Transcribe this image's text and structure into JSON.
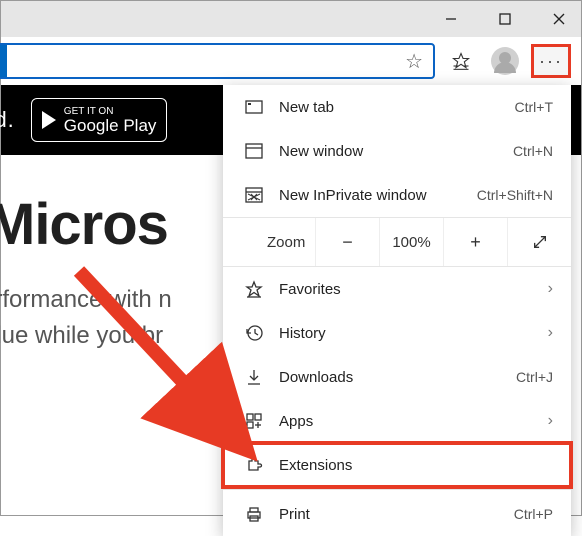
{
  "window": {
    "minimize": "—",
    "close": "×"
  },
  "toolbar": {
    "more": "···"
  },
  "banner": {
    "tail": "roid.",
    "gplay_small": "GET IT ON",
    "gplay_big": "Google Play"
  },
  "page": {
    "heading_fragment": "  Micros",
    "line1_fragment": "erformance with n",
    "line2_fragment": "alue while you br"
  },
  "menu": {
    "newtab": {
      "label": "New tab",
      "accel": "Ctrl+T"
    },
    "newwin": {
      "label": "New window",
      "accel": "Ctrl+N"
    },
    "inprivate": {
      "label": "New InPrivate window",
      "accel": "Ctrl+Shift+N"
    },
    "zoom": {
      "label": "Zoom",
      "value": "100%"
    },
    "favorites": {
      "label": "Favorites"
    },
    "history": {
      "label": "History"
    },
    "downloads": {
      "label": "Downloads",
      "accel": "Ctrl+J"
    },
    "apps": {
      "label": "Apps"
    },
    "extensions": {
      "label": "Extensions"
    },
    "print": {
      "label": "Print",
      "accel": "Ctrl+P"
    }
  }
}
